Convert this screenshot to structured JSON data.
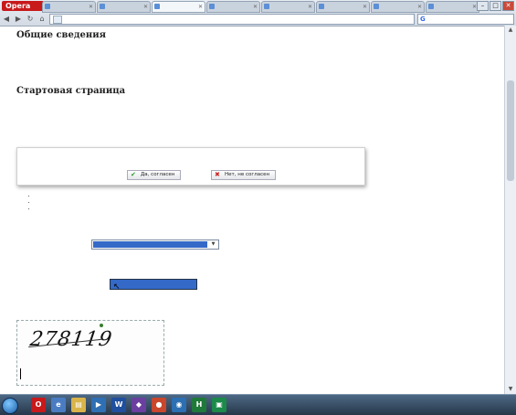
{
  "browser": {
    "opera_label": "Opera",
    "tabs": [
      {
        "label": "",
        "active": false
      },
      {
        "label": "",
        "active": false
      },
      {
        "label": "",
        "active": true
      },
      {
        "label": "",
        "active": false
      },
      {
        "label": "",
        "active": false
      },
      {
        "label": "",
        "active": false
      },
      {
        "label": "",
        "active": false
      },
      {
        "label": "",
        "active": false
      }
    ],
    "address": "",
    "search_placeholder": ""
  },
  "page": {
    "h_general": "Общие сведения",
    "p1": "",
    "p2": "",
    "h_start": "Стартовая страница",
    "p3": "",
    "modal": {
      "question": "",
      "agree_label": "Да, согласен",
      "disagree_label": "Нет, не согласен"
    },
    "p4": "",
    "p5": "",
    "list": [
      "",
      "",
      ""
    ],
    "p6": "",
    "region_label": "",
    "region_selected": "",
    "add_region_link": "",
    "p7": "",
    "region2_label": "",
    "region2_link": "",
    "region2_selected": "",
    "p8": "",
    "captcha": {
      "value": "278119",
      "refresh_link": "",
      "code_label": ""
    }
  },
  "taskbar": {
    "lang": "",
    "time": "",
    "date": ""
  }
}
